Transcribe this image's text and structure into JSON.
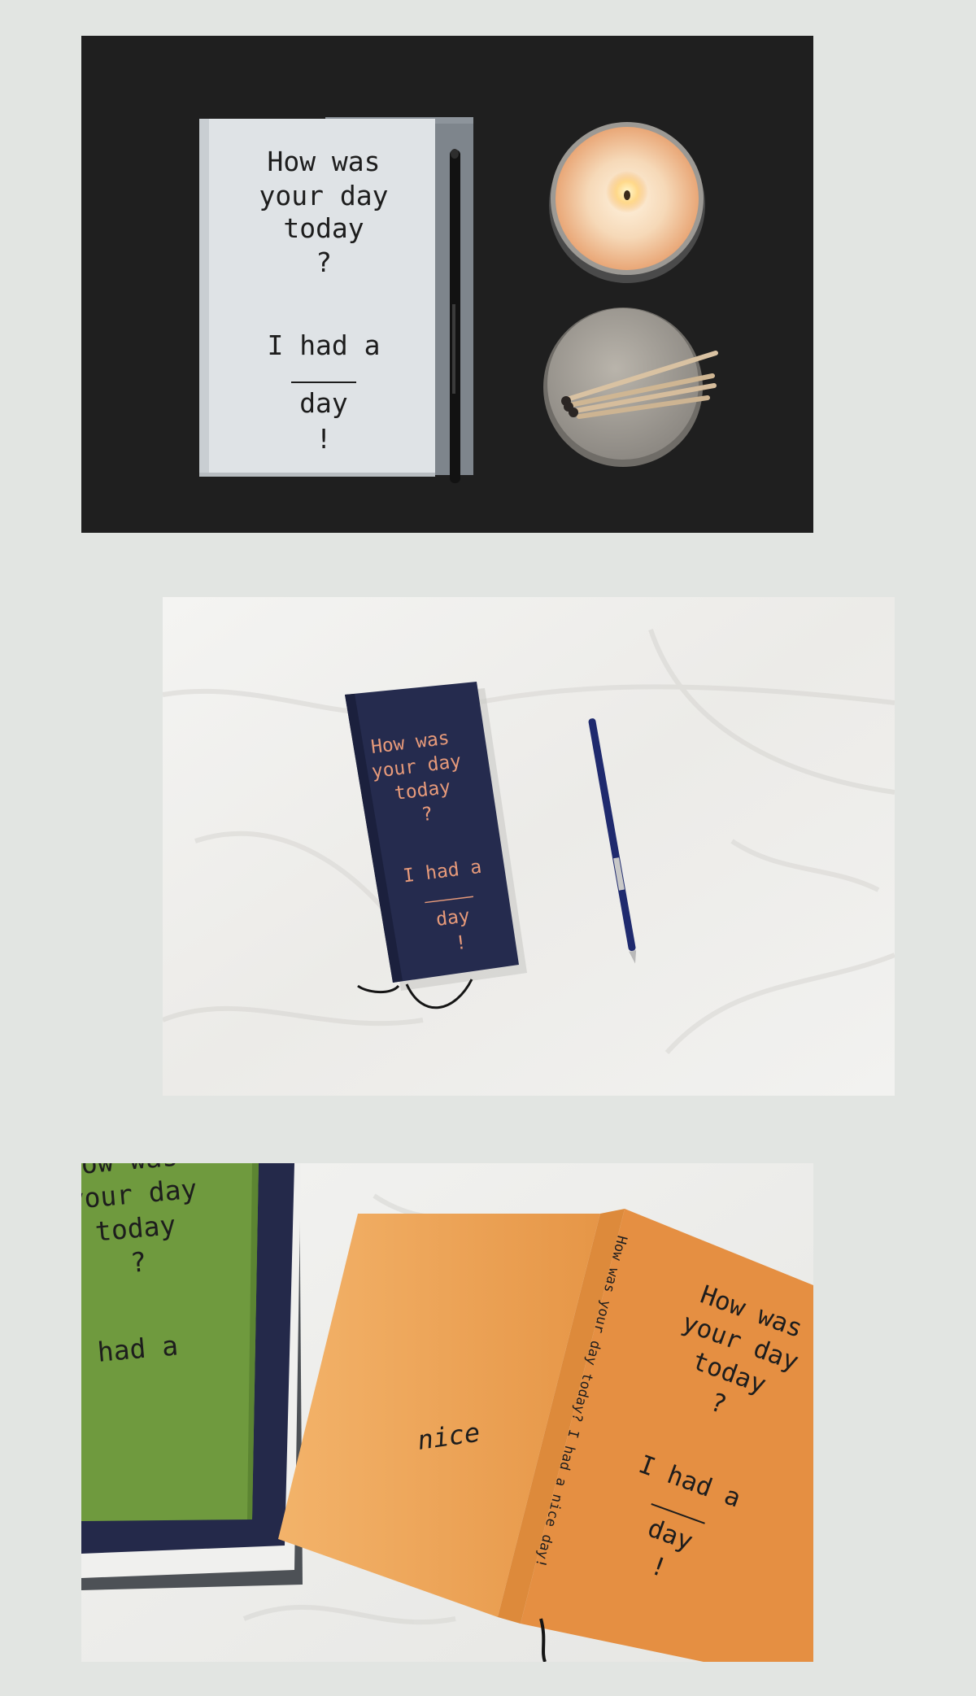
{
  "photos": [
    {
      "id": "dark-flatlay",
      "cover": {
        "line1": "How was",
        "line2": "your day",
        "line3": "today",
        "line4": "?",
        "line5": "I had a",
        "line6": "day",
        "line7": "!"
      },
      "colors": {
        "background": "#1f1f1f",
        "cover": "#dfe3e6",
        "text": "#1d1d1d"
      }
    },
    {
      "id": "navy-on-sheet",
      "cover": {
        "line1": "How was",
        "line2": "your day",
        "line3": "today",
        "line4": "?",
        "line5": "I had a",
        "line6": "day",
        "line7": "!"
      },
      "colors": {
        "background": "#efefee",
        "cover": "#252b4e",
        "text": "#e79a7a"
      }
    },
    {
      "id": "orange-open-book",
      "green_cover": {
        "line1": "How was",
        "line2": "your day",
        "line3": "today",
        "line4": "?",
        "line5": "I had a"
      },
      "orange_cover": {
        "line1": "How was",
        "line2": "your day",
        "line3": "today",
        "line4": "?",
        "line5": "I had a",
        "line6": "day",
        "line7": "!"
      },
      "spine": "How was your day today?  I had a nice day!",
      "back_word": "nice",
      "colors": {
        "background": "#ededec",
        "orange": "#eb9a4e",
        "green": "#6f9a3e",
        "text": "#1d1d1d"
      }
    }
  ]
}
